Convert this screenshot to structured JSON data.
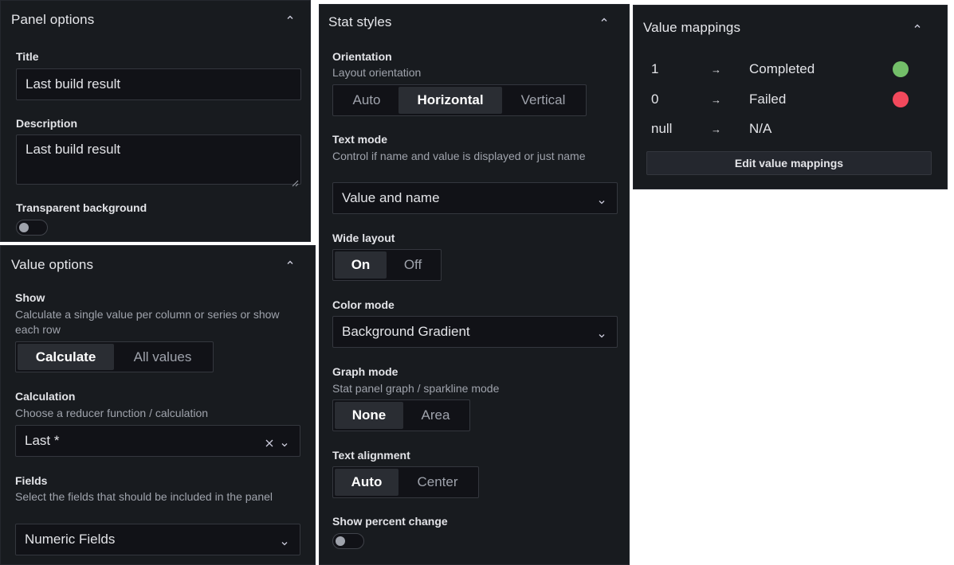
{
  "panel_options": {
    "title": "Panel options",
    "title_label": "Title",
    "title_value": "Last build result",
    "description_label": "Description",
    "description_value": "Last build result",
    "transparent_label": "Transparent background"
  },
  "value_options": {
    "title": "Value options",
    "show_label": "Show",
    "show_desc": "Calculate a single value per column or series or show each row",
    "show_options": [
      "Calculate",
      "All values"
    ],
    "show_selected": "Calculate",
    "calculation_label": "Calculation",
    "calculation_desc": "Choose a reducer function / calculation",
    "calculation_value": "Last *",
    "fields_label": "Fields",
    "fields_desc": "Select the fields that should be included in the panel",
    "fields_value": "Numeric Fields"
  },
  "stat_styles": {
    "title": "Stat styles",
    "orientation_label": "Orientation",
    "orientation_desc": "Layout orientation",
    "orientation_options": [
      "Auto",
      "Horizontal",
      "Vertical"
    ],
    "orientation_selected": "Horizontal",
    "text_mode_label": "Text mode",
    "text_mode_desc": "Control if name and value is displayed or just name",
    "text_mode_value": "Value and name",
    "wide_layout_label": "Wide layout",
    "wide_layout_options": [
      "On",
      "Off"
    ],
    "wide_layout_selected": "On",
    "color_mode_label": "Color mode",
    "color_mode_value": "Background Gradient",
    "graph_mode_label": "Graph mode",
    "graph_mode_desc": "Stat panel graph / sparkline mode",
    "graph_mode_options": [
      "None",
      "Area"
    ],
    "graph_mode_selected": "None",
    "text_alignment_label": "Text alignment",
    "text_alignment_options": [
      "Auto",
      "Center"
    ],
    "text_alignment_selected": "Auto",
    "percent_change_label": "Show percent change"
  },
  "value_mappings": {
    "title": "Value mappings",
    "rows": [
      {
        "value": "1",
        "arrow": "→",
        "text": "Completed",
        "color": "#73bf69"
      },
      {
        "value": "0",
        "arrow": "→",
        "text": "Failed",
        "color": "#f2495c"
      },
      {
        "value": "null",
        "arrow": "→",
        "text": "N/A"
      }
    ],
    "edit_button": "Edit value mappings"
  },
  "colors": {
    "panel_bg": "#181b1f",
    "input_bg": "#111217",
    "active_option_bg": "#2a2d33",
    "green": "#73bf69",
    "red": "#f2495c"
  }
}
